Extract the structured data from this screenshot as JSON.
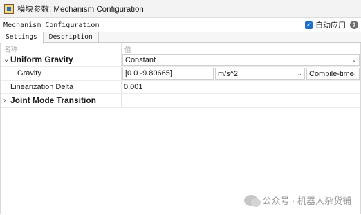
{
  "window": {
    "title": "模块参数: Mechanism Configuration"
  },
  "header": {
    "block_name": "Mechanism Configuration",
    "auto_apply_label": "自动应用",
    "auto_apply_checked": true
  },
  "tabs": [
    {
      "label": "Settings",
      "active": true
    },
    {
      "label": "Description",
      "active": false
    }
  ],
  "columns": {
    "name": "名称",
    "value": "值"
  },
  "rows": {
    "uniform_gravity": {
      "label": "Uniform Gravity",
      "expanded": true,
      "value": "Constant"
    },
    "gravity": {
      "label": "Gravity",
      "value": "[0 0 -9.80665]",
      "unit": "m/s^2",
      "mode": "Compile-time"
    },
    "linearization_delta": {
      "label": "Linearization Delta",
      "value": "0.001"
    },
    "joint_mode_transition": {
      "label": "Joint Mode Transition",
      "expanded": false
    }
  },
  "watermark": {
    "text": "公众号 · 机器人杂货铺"
  }
}
